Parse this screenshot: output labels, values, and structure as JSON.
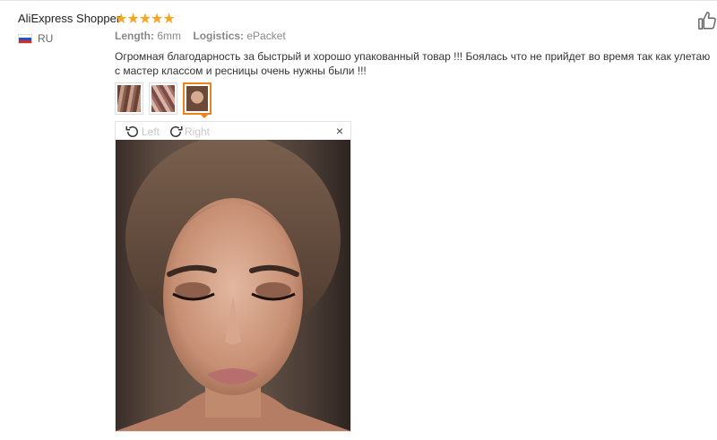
{
  "review": {
    "buyer_name": "AliExpress Shopper",
    "rating_stars": "★★★★★",
    "rating": 5,
    "country_code": "RU",
    "length_label": "Length:",
    "length_value": "6mm",
    "logistics_label": "Logistics:",
    "logistics_value": "ePacket",
    "text": "Огромная благодарность за быстрый и хорошо упакованный товар !!! Боялась что не прийдет во время так как улетаю с мастер классом и ресницы очень нужны были !!!"
  },
  "viewer": {
    "rotate_left_label": "Left",
    "rotate_right_label": "Right",
    "close_symbol": "×"
  },
  "colors": {
    "star": "#f4a623",
    "active_thumb": "#f0821e"
  },
  "icons": [
    "thumbs-up-icon",
    "rotate-left-icon",
    "rotate-right-icon",
    "close-icon",
    "flag-ru-icon",
    "star-icon"
  ]
}
